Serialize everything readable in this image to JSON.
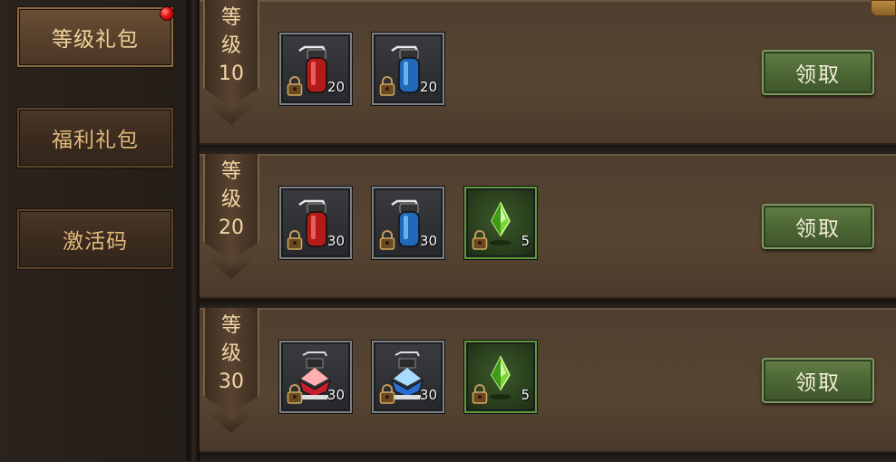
{
  "sidebar": {
    "items": [
      {
        "label": "等级礼包",
        "active": true,
        "badge": true
      },
      {
        "label": "福利礼包",
        "active": false,
        "badge": false
      },
      {
        "label": "激活码",
        "active": false,
        "badge": false
      }
    ]
  },
  "rewards": [
    {
      "level_chars": [
        "等",
        "级"
      ],
      "level_value": "10",
      "items": [
        {
          "icon": "red-potion-icon",
          "count": "20",
          "locked": true
        },
        {
          "icon": "blue-potion-icon",
          "count": "20",
          "locked": true
        }
      ],
      "claim_label": "领取"
    },
    {
      "level_chars": [
        "等",
        "级"
      ],
      "level_value": "20",
      "items": [
        {
          "icon": "red-potion-icon",
          "count": "30",
          "locked": true
        },
        {
          "icon": "blue-potion-icon",
          "count": "30",
          "locked": true
        },
        {
          "icon": "green-gem-icon",
          "count": "5",
          "locked": true
        }
      ],
      "claim_label": "领取"
    },
    {
      "level_chars": [
        "等",
        "级"
      ],
      "level_value": "30",
      "items": [
        {
          "icon": "large-red-potion-icon",
          "count": "30",
          "locked": true
        },
        {
          "icon": "large-blue-potion-icon",
          "count": "30",
          "locked": true
        },
        {
          "icon": "green-gem-icon",
          "count": "5",
          "locked": true
        }
      ],
      "claim_label": "领取"
    }
  ],
  "colors": {
    "accent_text": "#e3b979",
    "claim_button": "#4d6735",
    "gem_slot_border": "#5e9a3a"
  }
}
